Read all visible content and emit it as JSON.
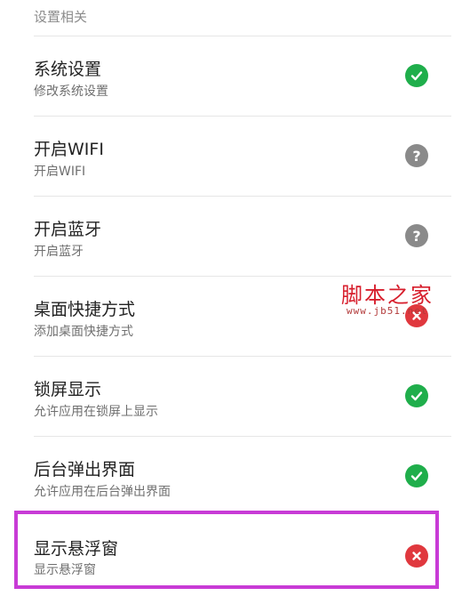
{
  "section_header": "设置相关",
  "items": [
    {
      "title": "系统设置",
      "subtitle": "修改系统设置",
      "status": "allowed",
      "status_icon": "check-icon",
      "status_color": "#1fae4b"
    },
    {
      "title": "开启WIFI",
      "subtitle": "开启WIFI",
      "status": "ask",
      "status_icon": "question-icon",
      "status_color": "#8a8a8a"
    },
    {
      "title": "开启蓝牙",
      "subtitle": "开启蓝牙",
      "status": "ask",
      "status_icon": "question-icon",
      "status_color": "#8a8a8a"
    },
    {
      "title": "桌面快捷方式",
      "subtitle": "添加桌面快捷方式",
      "status": "denied",
      "status_icon": "close-icon",
      "status_color": "#e0383e"
    },
    {
      "title": "锁屏显示",
      "subtitle": "允许应用在锁屏上显示",
      "status": "allowed",
      "status_icon": "check-icon",
      "status_color": "#1fae4b"
    },
    {
      "title": "后台弹出界面",
      "subtitle": "允许应用在后台弹出界面",
      "status": "allowed",
      "status_icon": "check-icon",
      "status_color": "#1fae4b"
    },
    {
      "title": "显示悬浮窗",
      "subtitle": "显示悬浮窗",
      "status": "denied",
      "status_icon": "close-icon",
      "status_color": "#e0383e"
    }
  ],
  "highlight_color": "#c83bd6",
  "watermark": {
    "text": "脚本之家",
    "url": "www.jb51.net"
  }
}
